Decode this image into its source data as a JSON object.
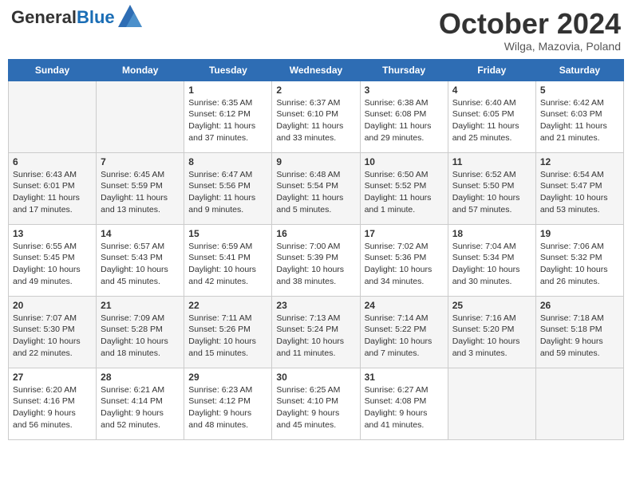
{
  "header": {
    "logo_line1": "General",
    "logo_line2": "Blue",
    "month": "October 2024",
    "location": "Wilga, Mazovia, Poland"
  },
  "days_of_week": [
    "Sunday",
    "Monday",
    "Tuesday",
    "Wednesday",
    "Thursday",
    "Friday",
    "Saturday"
  ],
  "weeks": [
    [
      {
        "day": "",
        "info": ""
      },
      {
        "day": "",
        "info": ""
      },
      {
        "day": "1",
        "info": "Sunrise: 6:35 AM\nSunset: 6:12 PM\nDaylight: 11 hours and 37 minutes."
      },
      {
        "day": "2",
        "info": "Sunrise: 6:37 AM\nSunset: 6:10 PM\nDaylight: 11 hours and 33 minutes."
      },
      {
        "day": "3",
        "info": "Sunrise: 6:38 AM\nSunset: 6:08 PM\nDaylight: 11 hours and 29 minutes."
      },
      {
        "day": "4",
        "info": "Sunrise: 6:40 AM\nSunset: 6:05 PM\nDaylight: 11 hours and 25 minutes."
      },
      {
        "day": "5",
        "info": "Sunrise: 6:42 AM\nSunset: 6:03 PM\nDaylight: 11 hours and 21 minutes."
      }
    ],
    [
      {
        "day": "6",
        "info": "Sunrise: 6:43 AM\nSunset: 6:01 PM\nDaylight: 11 hours and 17 minutes."
      },
      {
        "day": "7",
        "info": "Sunrise: 6:45 AM\nSunset: 5:59 PM\nDaylight: 11 hours and 13 minutes."
      },
      {
        "day": "8",
        "info": "Sunrise: 6:47 AM\nSunset: 5:56 PM\nDaylight: 11 hours and 9 minutes."
      },
      {
        "day": "9",
        "info": "Sunrise: 6:48 AM\nSunset: 5:54 PM\nDaylight: 11 hours and 5 minutes."
      },
      {
        "day": "10",
        "info": "Sunrise: 6:50 AM\nSunset: 5:52 PM\nDaylight: 11 hours and 1 minute."
      },
      {
        "day": "11",
        "info": "Sunrise: 6:52 AM\nSunset: 5:50 PM\nDaylight: 10 hours and 57 minutes."
      },
      {
        "day": "12",
        "info": "Sunrise: 6:54 AM\nSunset: 5:47 PM\nDaylight: 10 hours and 53 minutes."
      }
    ],
    [
      {
        "day": "13",
        "info": "Sunrise: 6:55 AM\nSunset: 5:45 PM\nDaylight: 10 hours and 49 minutes."
      },
      {
        "day": "14",
        "info": "Sunrise: 6:57 AM\nSunset: 5:43 PM\nDaylight: 10 hours and 45 minutes."
      },
      {
        "day": "15",
        "info": "Sunrise: 6:59 AM\nSunset: 5:41 PM\nDaylight: 10 hours and 42 minutes."
      },
      {
        "day": "16",
        "info": "Sunrise: 7:00 AM\nSunset: 5:39 PM\nDaylight: 10 hours and 38 minutes."
      },
      {
        "day": "17",
        "info": "Sunrise: 7:02 AM\nSunset: 5:36 PM\nDaylight: 10 hours and 34 minutes."
      },
      {
        "day": "18",
        "info": "Sunrise: 7:04 AM\nSunset: 5:34 PM\nDaylight: 10 hours and 30 minutes."
      },
      {
        "day": "19",
        "info": "Sunrise: 7:06 AM\nSunset: 5:32 PM\nDaylight: 10 hours and 26 minutes."
      }
    ],
    [
      {
        "day": "20",
        "info": "Sunrise: 7:07 AM\nSunset: 5:30 PM\nDaylight: 10 hours and 22 minutes."
      },
      {
        "day": "21",
        "info": "Sunrise: 7:09 AM\nSunset: 5:28 PM\nDaylight: 10 hours and 18 minutes."
      },
      {
        "day": "22",
        "info": "Sunrise: 7:11 AM\nSunset: 5:26 PM\nDaylight: 10 hours and 15 minutes."
      },
      {
        "day": "23",
        "info": "Sunrise: 7:13 AM\nSunset: 5:24 PM\nDaylight: 10 hours and 11 minutes."
      },
      {
        "day": "24",
        "info": "Sunrise: 7:14 AM\nSunset: 5:22 PM\nDaylight: 10 hours and 7 minutes."
      },
      {
        "day": "25",
        "info": "Sunrise: 7:16 AM\nSunset: 5:20 PM\nDaylight: 10 hours and 3 minutes."
      },
      {
        "day": "26",
        "info": "Sunrise: 7:18 AM\nSunset: 5:18 PM\nDaylight: 9 hours and 59 minutes."
      }
    ],
    [
      {
        "day": "27",
        "info": "Sunrise: 6:20 AM\nSunset: 4:16 PM\nDaylight: 9 hours and 56 minutes."
      },
      {
        "day": "28",
        "info": "Sunrise: 6:21 AM\nSunset: 4:14 PM\nDaylight: 9 hours and 52 minutes."
      },
      {
        "day": "29",
        "info": "Sunrise: 6:23 AM\nSunset: 4:12 PM\nDaylight: 9 hours and 48 minutes."
      },
      {
        "day": "30",
        "info": "Sunrise: 6:25 AM\nSunset: 4:10 PM\nDaylight: 9 hours and 45 minutes."
      },
      {
        "day": "31",
        "info": "Sunrise: 6:27 AM\nSunset: 4:08 PM\nDaylight: 9 hours and 41 minutes."
      },
      {
        "day": "",
        "info": ""
      },
      {
        "day": "",
        "info": ""
      }
    ]
  ]
}
